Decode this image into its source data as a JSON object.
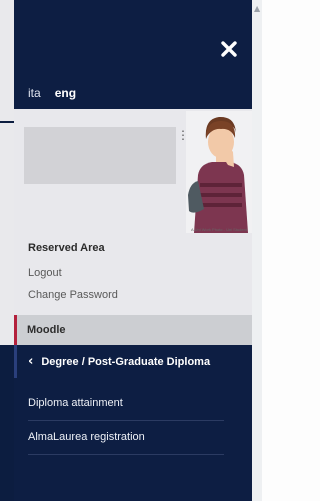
{
  "language": {
    "options": [
      "ita",
      "eng"
    ],
    "active": "eng"
  },
  "icons": {
    "close": "close-icon",
    "back": "chevron-left-icon",
    "more": "vertical-dots-icon"
  },
  "reserved_area": {
    "title": "Reserved Area",
    "links": [
      "Logout",
      "Change Password"
    ],
    "avatar_credit": "A Uni Work Photo - Uni Student"
  },
  "moodle": {
    "label": "Moodle"
  },
  "submenu": {
    "header": "Degree / Post-Graduate Diploma",
    "items": [
      "Diploma attainment",
      "AlmaLaurea registration"
    ]
  },
  "colors": {
    "navy": "#0d1e43",
    "panel": "#e8e8ec",
    "accent_red": "#b3203c",
    "accent_blue": "#2a3f7c"
  }
}
